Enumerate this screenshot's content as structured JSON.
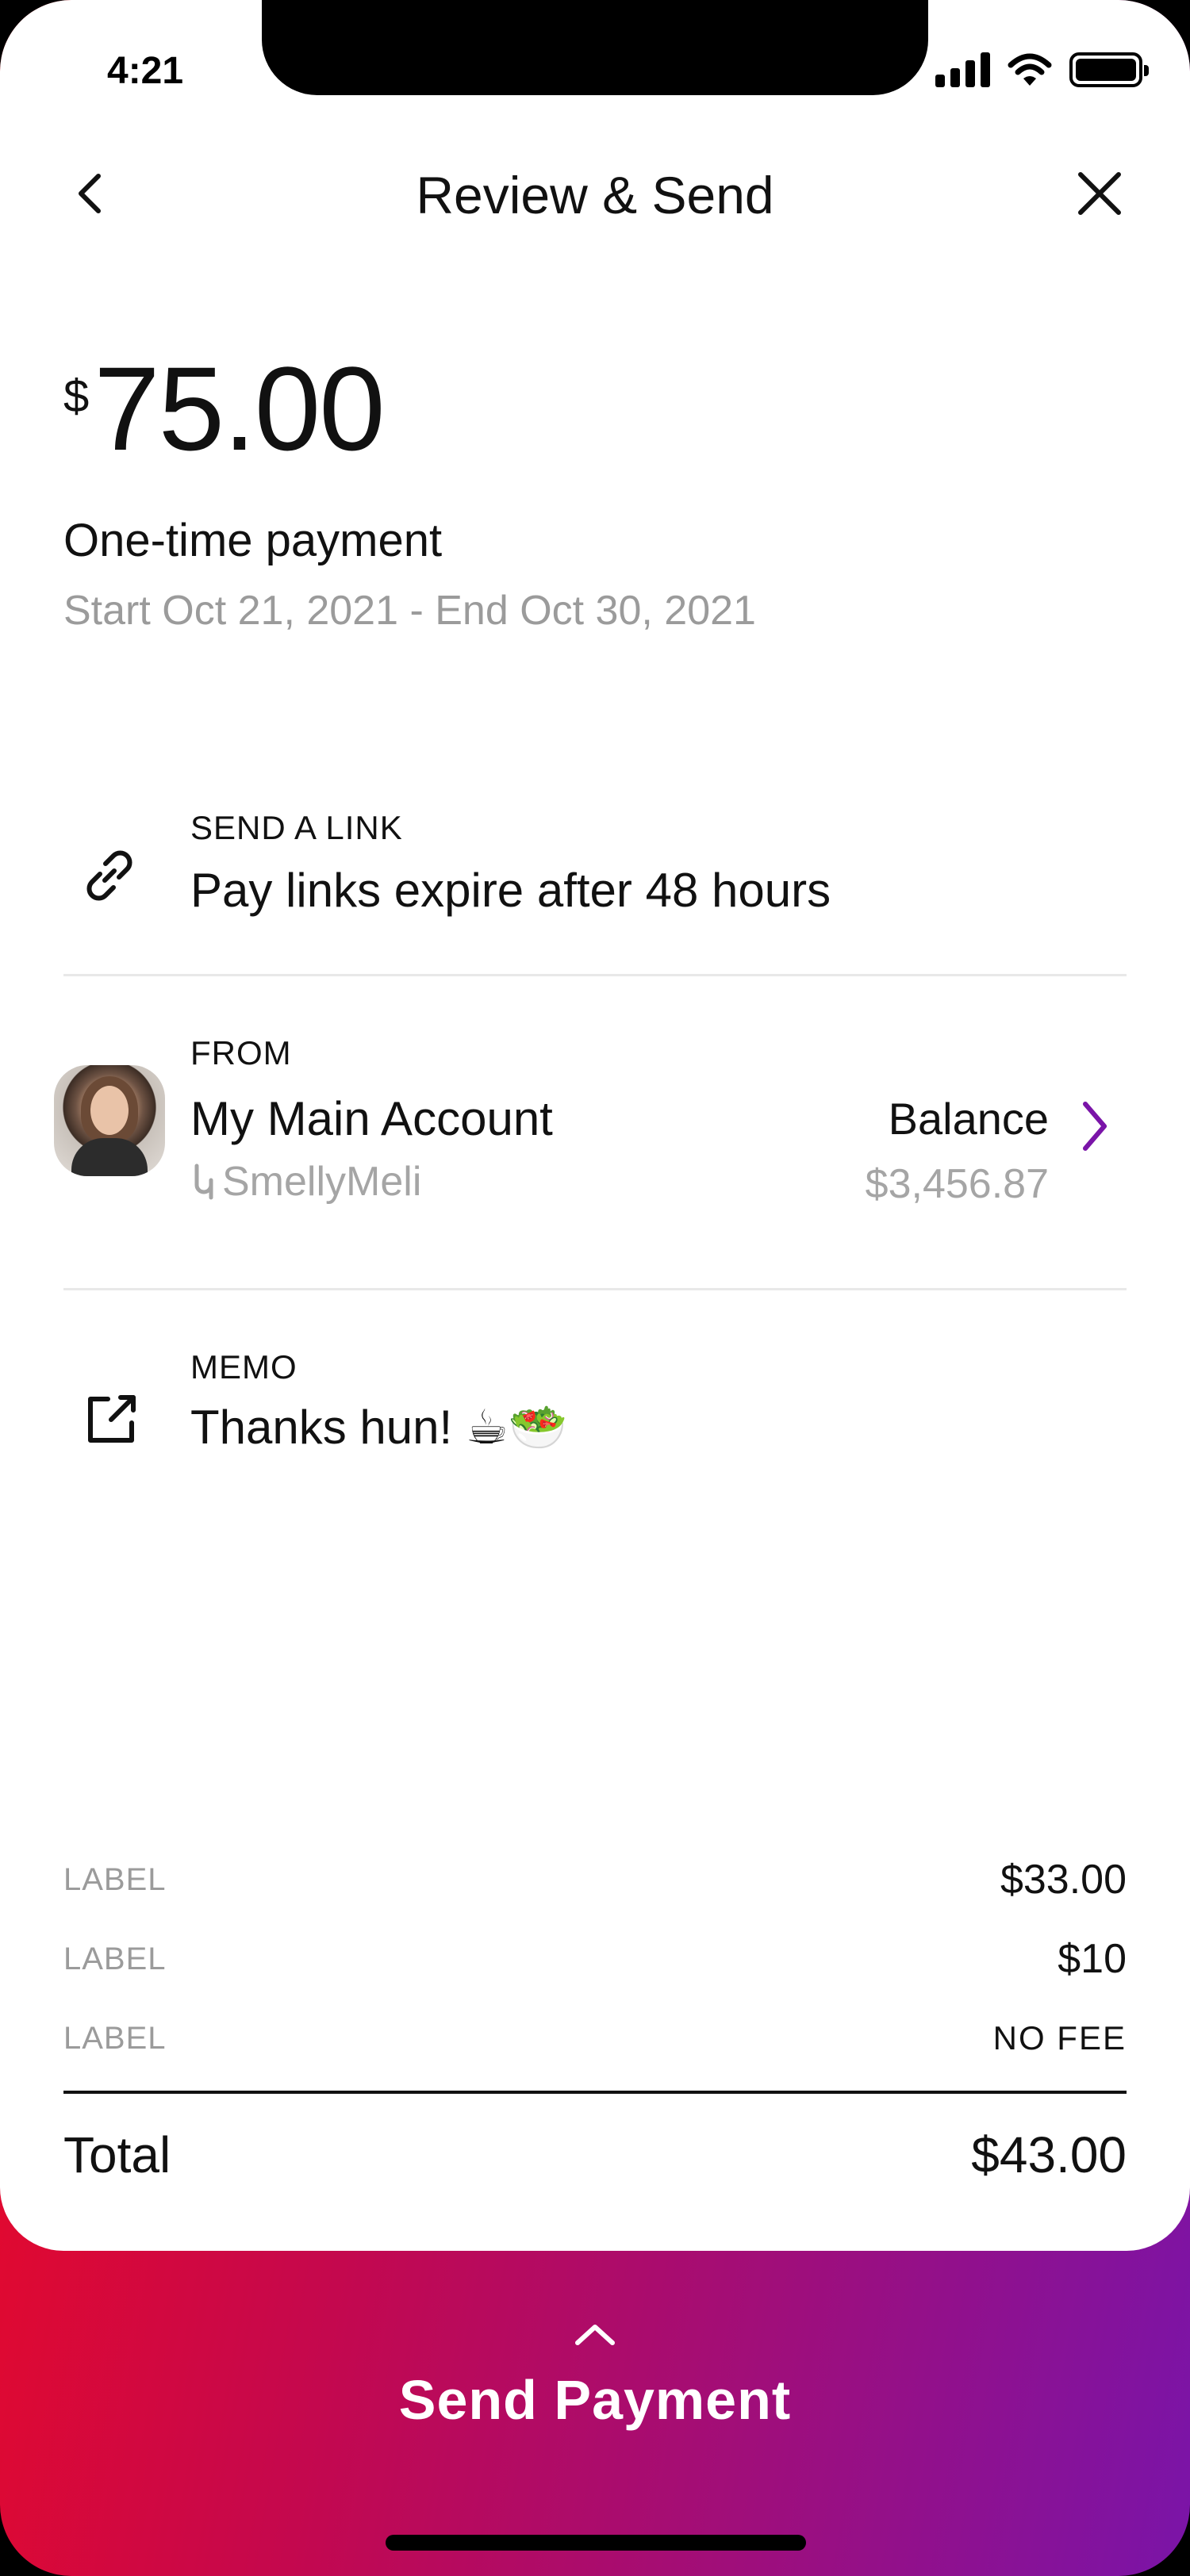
{
  "status_bar": {
    "time": "4:21"
  },
  "header": {
    "title": "Review & Send"
  },
  "payment": {
    "currency_symbol": "$",
    "amount": "75.00",
    "type": "One-time payment",
    "date_range": "Start Oct 21, 2021 - End Oct 30, 2021"
  },
  "send_link": {
    "label": "SEND A LINK",
    "text": "Pay links expire after 48 hours",
    "icon": "link-icon"
  },
  "from": {
    "label": "FROM",
    "account": "My Main Account",
    "handle": "SmellyMeli",
    "balance_label": "Balance",
    "balance_value": "$3,456.87"
  },
  "memo": {
    "label": "MEMO",
    "text": "Thanks hun! ☕🥗",
    "icon": "edit-icon"
  },
  "fees": [
    {
      "label": "LABEL",
      "value": "$33.00"
    },
    {
      "label": "LABEL",
      "value": "$10"
    },
    {
      "label": "LABEL",
      "value": "NO FEE"
    }
  ],
  "total": {
    "label": "Total",
    "value": "$43.00"
  },
  "cta": {
    "label": "Send Payment"
  },
  "colors": {
    "accent_purple": "#7a14a8",
    "gradient_start": "#ff0a10",
    "gradient_mid": "#c4084e",
    "gradient_end": "#7a14a8",
    "muted_text": "#9b9b9b"
  }
}
